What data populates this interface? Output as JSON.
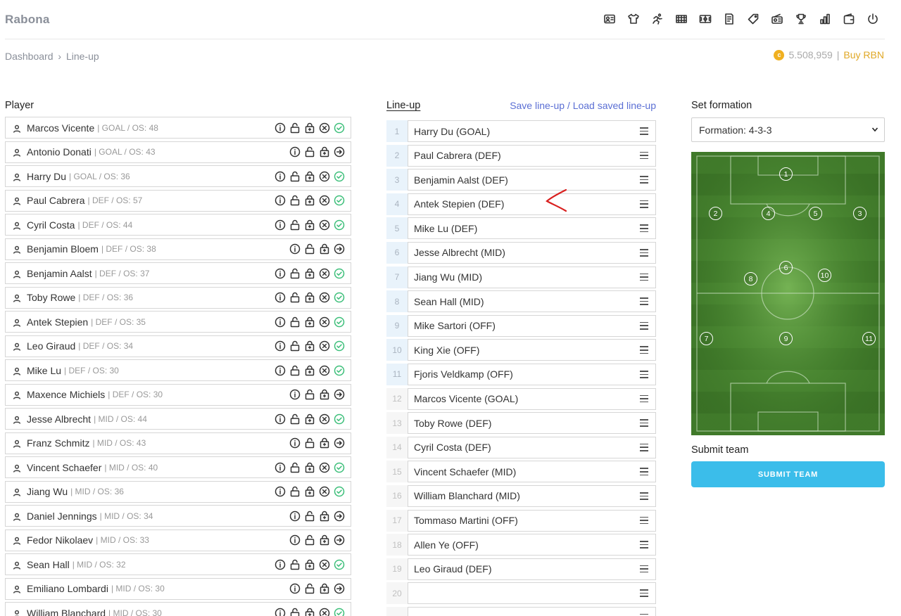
{
  "app": {
    "brand": "Rabona"
  },
  "nav": {
    "icons": [
      "id-card-icon",
      "shirt-icon",
      "runner-icon",
      "stadium-icon",
      "pitch-icon",
      "document-icon",
      "tag-icon",
      "radio-icon",
      "trophy-icon",
      "bar-chart-icon",
      "wallet-icon",
      "power-icon"
    ]
  },
  "breadcrumb": {
    "root": "Dashboard",
    "separator": "›",
    "current": "Line-up"
  },
  "wallet": {
    "coin_symbol": "c",
    "balance": "5.508,959",
    "divider": "|",
    "buy_label": "Buy RBN"
  },
  "players": {
    "title": "Player",
    "items": [
      {
        "name": "Marcos Vicente",
        "meta": "| GOAL / OS: 48",
        "in_lineup": true
      },
      {
        "name": "Antonio Donati",
        "meta": "| GOAL / OS: 43",
        "in_lineup": false
      },
      {
        "name": "Harry Du",
        "meta": "| GOAL / OS: 36",
        "in_lineup": true
      },
      {
        "name": "Paul Cabrera",
        "meta": "| DEF / OS: 57",
        "in_lineup": true
      },
      {
        "name": "Cyril Costa",
        "meta": "| DEF / OS: 44",
        "in_lineup": true
      },
      {
        "name": "Benjamin Bloem",
        "meta": "| DEF / OS: 38",
        "in_lineup": false
      },
      {
        "name": "Benjamin Aalst",
        "meta": "| DEF / OS: 37",
        "in_lineup": true
      },
      {
        "name": "Toby Rowe",
        "meta": "| DEF / OS: 36",
        "in_lineup": true
      },
      {
        "name": "Antek Stepien",
        "meta": "| DEF / OS: 35",
        "in_lineup": true
      },
      {
        "name": "Leo Giraud",
        "meta": "| DEF / OS: 34",
        "in_lineup": true
      },
      {
        "name": "Mike Lu",
        "meta": "| DEF / OS: 30",
        "in_lineup": true
      },
      {
        "name": "Maxence Michiels",
        "meta": "| DEF / OS: 30",
        "in_lineup": false
      },
      {
        "name": "Jesse Albrecht",
        "meta": "| MID / OS: 44",
        "in_lineup": true
      },
      {
        "name": "Franz Schmitz",
        "meta": "| MID / OS: 43",
        "in_lineup": false
      },
      {
        "name": "Vincent Schaefer",
        "meta": "| MID / OS: 40",
        "in_lineup": true
      },
      {
        "name": "Jiang Wu",
        "meta": "| MID / OS: 36",
        "in_lineup": true
      },
      {
        "name": "Daniel Jennings",
        "meta": "| MID / OS: 34",
        "in_lineup": false
      },
      {
        "name": "Fedor Nikolaev",
        "meta": "| MID / OS: 33",
        "in_lineup": false
      },
      {
        "name": "Sean Hall",
        "meta": "| MID / OS: 32",
        "in_lineup": true
      },
      {
        "name": "Emiliano Lombardi",
        "meta": "| MID / OS: 30",
        "in_lineup": false
      },
      {
        "name": "William Blanchard",
        "meta": "| MID / OS: 30",
        "in_lineup": true
      }
    ]
  },
  "lineup": {
    "title": "Line-up",
    "save_label": "Save line-up",
    "slash": " / ",
    "load_label": "Load saved line-up",
    "slots": [
      {
        "num": "1",
        "player": "Harry Du (GOAL)"
      },
      {
        "num": "2",
        "player": "Paul Cabrera (DEF)"
      },
      {
        "num": "3",
        "player": "Benjamin Aalst (DEF)"
      },
      {
        "num": "4",
        "player": "Antek Stepien (DEF)"
      },
      {
        "num": "5",
        "player": "Mike Lu (DEF)"
      },
      {
        "num": "6",
        "player": "Jesse Albrecht (MID)"
      },
      {
        "num": "7",
        "player": "Jiang Wu (MID)"
      },
      {
        "num": "8",
        "player": "Sean Hall (MID)"
      },
      {
        "num": "9",
        "player": "Mike Sartori (OFF)"
      },
      {
        "num": "10",
        "player": "King Xie (OFF)"
      },
      {
        "num": "11",
        "player": "Fjoris Veldkamp (OFF)"
      },
      {
        "num": "12",
        "player": "Marcos Vicente (GOAL)"
      },
      {
        "num": "13",
        "player": "Toby Rowe (DEF)"
      },
      {
        "num": "14",
        "player": "Cyril Costa (DEF)"
      },
      {
        "num": "15",
        "player": "Vincent Schaefer (MID)"
      },
      {
        "num": "16",
        "player": "William Blanchard (MID)"
      },
      {
        "num": "17",
        "player": "Tommaso Martini (OFF)"
      },
      {
        "num": "18",
        "player": "Allen Ye (OFF)"
      },
      {
        "num": "19",
        "player": "Leo Giraud (DEF)"
      },
      {
        "num": "20",
        "player": ""
      },
      {
        "num": "",
        "player": ""
      }
    ]
  },
  "formation": {
    "title": "Set formation",
    "selected": "Formation: 4-3-3",
    "positions": [
      "1",
      "2",
      "4",
      "5",
      "3",
      "6",
      "8",
      "10",
      "7",
      "9",
      "11"
    ],
    "pitch_colors": {
      "dark": "#3f7a2a",
      "light": "#4c8a33",
      "center": "#6aa84a"
    }
  },
  "submit": {
    "title": "Submit team",
    "button_label": "SUBMIT TEAM"
  },
  "colors": {
    "accent": "#3bbdea",
    "link": "#5b6fd4",
    "check": "#3dbf7a",
    "gold": "#e0a826"
  }
}
